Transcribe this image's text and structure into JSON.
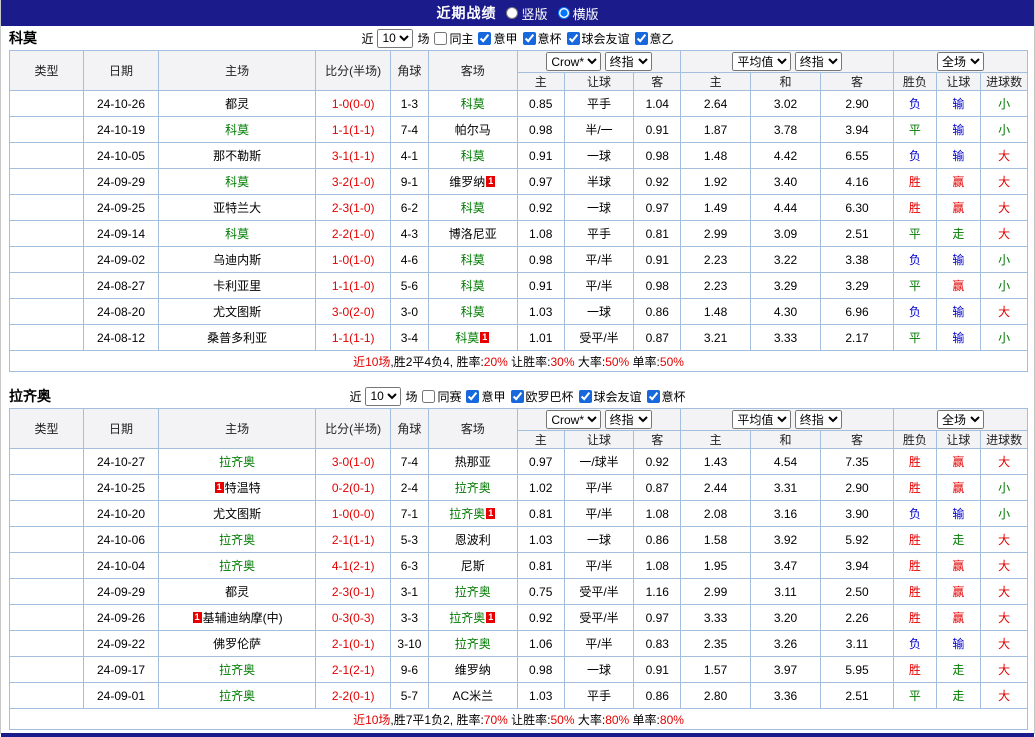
{
  "colors": {
    "navy": "#1b1b8c",
    "red": "#e60000",
    "blue": "#0000d0",
    "green": "#007b00",
    "black": "#000000",
    "league_blue": "#0f8ff0",
    "league_purple": "#8420a8",
    "border": "#a3bfdd"
  },
  "result_color_map": {
    "胜": "red",
    "平": "green",
    "负": "blue",
    "赢": "red",
    "走": "green",
    "输": "blue",
    "大": "red",
    "小": "green"
  },
  "topbar": {
    "title": "近期战绩",
    "options": [
      {
        "label": "竖版",
        "checked": false
      },
      {
        "label": "横版",
        "checked": true
      }
    ]
  },
  "filters_labels": {
    "near": "近",
    "games": "场"
  },
  "table_headers": {
    "type": "类型",
    "date": "日期",
    "home": "主场",
    "score": "比分(半场)",
    "corner": "角球",
    "away": "客场",
    "company_dd": "Crow*",
    "final_dd": "终指",
    "avg_dd": "平均值",
    "final2_dd": "终指",
    "full_dd": "全场",
    "h_home": "主",
    "h_handicap": "让球",
    "h_away": "客",
    "a_home": "主",
    "a_draw": "和",
    "a_away": "客",
    "f_result": "胜负",
    "f_handicap": "让球",
    "f_goals": "进球数"
  },
  "sections": [
    {
      "team": "科莫",
      "filters": {
        "count": "10",
        "same_label": "同主",
        "same_checked": false,
        "leagues": [
          {
            "label": "意甲",
            "checked": true
          },
          {
            "label": "意杯",
            "checked": true
          },
          {
            "label": "球会友谊",
            "checked": true
          },
          {
            "label": "意乙",
            "checked": true
          }
        ]
      },
      "rows": [
        {
          "league": "意甲",
          "lcolor": "blue",
          "date": "24-10-26",
          "home": {
            "name": "都灵"
          },
          "score": "1-0(0-0)",
          "corner": "1-3",
          "away": {
            "name": "科莫",
            "subject": true
          },
          "odds": [
            "0.85",
            "平手",
            "1.04"
          ],
          "avg": [
            "2.64",
            "3.02",
            "2.90"
          ],
          "res": [
            "负",
            "输",
            "小"
          ]
        },
        {
          "league": "意甲",
          "lcolor": "blue",
          "date": "24-10-19",
          "home": {
            "name": "科莫",
            "subject": true
          },
          "score": "1-1(1-1)",
          "corner": "7-4",
          "away": {
            "name": "帕尔马"
          },
          "odds": [
            "0.98",
            "半/一",
            "0.91"
          ],
          "avg": [
            "1.87",
            "3.78",
            "3.94"
          ],
          "res": [
            "平",
            "输",
            "小"
          ]
        },
        {
          "league": "意甲",
          "lcolor": "blue",
          "date": "24-10-05",
          "home": {
            "name": "那不勒斯"
          },
          "score": "3-1(1-1)",
          "corner": "4-1",
          "away": {
            "name": "科莫",
            "subject": true
          },
          "odds": [
            "0.91",
            "一球",
            "0.98"
          ],
          "avg": [
            "1.48",
            "4.42",
            "6.55"
          ],
          "res": [
            "负",
            "输",
            "大"
          ]
        },
        {
          "league": "意甲",
          "lcolor": "blue",
          "date": "24-09-29",
          "home": {
            "name": "科莫",
            "subject": true
          },
          "score": "3-2(1-0)",
          "corner": "9-1",
          "away": {
            "name": "维罗纳",
            "badge": {
              "text": "1",
              "pos": "after"
            }
          },
          "odds": [
            "0.97",
            "半球",
            "0.92"
          ],
          "avg": [
            "1.92",
            "3.40",
            "4.16"
          ],
          "res": [
            "胜",
            "赢",
            "大"
          ]
        },
        {
          "league": "意甲",
          "lcolor": "blue",
          "date": "24-09-25",
          "home": {
            "name": "亚特兰大"
          },
          "score": "2-3(1-0)",
          "corner": "6-2",
          "away": {
            "name": "科莫",
            "subject": true
          },
          "odds": [
            "0.92",
            "一球",
            "0.97"
          ],
          "avg": [
            "1.49",
            "4.44",
            "6.30"
          ],
          "res": [
            "胜",
            "赢",
            "大"
          ]
        },
        {
          "league": "意甲",
          "lcolor": "blue",
          "date": "24-09-14",
          "home": {
            "name": "科莫",
            "subject": true
          },
          "score": "2-2(1-0)",
          "corner": "4-3",
          "away": {
            "name": "博洛尼亚"
          },
          "odds": [
            "1.08",
            "平手",
            "0.81"
          ],
          "avg": [
            "2.99",
            "3.09",
            "2.51"
          ],
          "res": [
            "平",
            "走",
            "大"
          ]
        },
        {
          "league": "意甲",
          "lcolor": "blue",
          "date": "24-09-02",
          "home": {
            "name": "乌迪内斯"
          },
          "score": "1-0(1-0)",
          "corner": "4-6",
          "away": {
            "name": "科莫",
            "subject": true
          },
          "odds": [
            "0.98",
            "平/半",
            "0.91"
          ],
          "avg": [
            "2.23",
            "3.22",
            "3.38"
          ],
          "res": [
            "负",
            "输",
            "小"
          ]
        },
        {
          "league": "意甲",
          "lcolor": "blue",
          "date": "24-08-27",
          "home": {
            "name": "卡利亚里"
          },
          "score": "1-1(1-0)",
          "corner": "5-6",
          "away": {
            "name": "科莫",
            "subject": true
          },
          "odds": [
            "0.91",
            "平/半",
            "0.98"
          ],
          "avg": [
            "2.23",
            "3.29",
            "3.29"
          ],
          "res": [
            "平",
            "赢",
            "小"
          ]
        },
        {
          "league": "意甲",
          "lcolor": "blue",
          "date": "24-08-20",
          "home": {
            "name": "尤文图斯"
          },
          "score": "3-0(2-0)",
          "corner": "3-0",
          "away": {
            "name": "科莫",
            "subject": true
          },
          "odds": [
            "1.03",
            "一球",
            "0.86"
          ],
          "avg": [
            "1.48",
            "4.30",
            "6.96"
          ],
          "res": [
            "负",
            "输",
            "大"
          ]
        },
        {
          "league": "意杯",
          "lcolor": "purple",
          "date": "24-08-12",
          "home": {
            "name": "桑普多利亚"
          },
          "score": "1-1(1-1)",
          "corner": "3-4",
          "away": {
            "name": "科莫",
            "subject": true,
            "badge": {
              "text": "1",
              "pos": "after"
            }
          },
          "odds": [
            "1.01",
            "受平/半",
            "0.87"
          ],
          "avg": [
            "3.21",
            "3.33",
            "2.17"
          ],
          "res": [
            "平",
            "输",
            "小"
          ]
        }
      ],
      "summary": [
        [
          "近10场",
          "red"
        ],
        [
          ",胜2平4负4, 胜率:",
          "black"
        ],
        [
          "20%",
          "red"
        ],
        [
          " 让胜率:",
          "black"
        ],
        [
          "30%",
          "red"
        ],
        [
          " 大率:",
          "black"
        ],
        [
          "50%",
          "red"
        ],
        [
          " 单率:",
          "black"
        ],
        [
          "50%",
          "red"
        ]
      ]
    },
    {
      "team": "拉齐奥",
      "filters": {
        "count": "10",
        "same_label": "同赛",
        "same_checked": false,
        "leagues": [
          {
            "label": "意甲",
            "checked": true
          },
          {
            "label": "欧罗巴杯",
            "checked": true
          },
          {
            "label": "球会友谊",
            "checked": true
          },
          {
            "label": "意杯",
            "checked": true
          }
        ]
      },
      "rows": [
        {
          "league": "意甲",
          "lcolor": "blue",
          "date": "24-10-27",
          "home": {
            "name": "拉齐奥",
            "subject": true
          },
          "score": "3-0(1-0)",
          "corner": "7-4",
          "away": {
            "name": "热那亚"
          },
          "odds": [
            "0.97",
            "一/球半",
            "0.92"
          ],
          "avg": [
            "1.43",
            "4.54",
            "7.35"
          ],
          "res": [
            "胜",
            "赢",
            "大"
          ]
        },
        {
          "league": "欧罗巴杯",
          "lcolor": "purple",
          "date": "24-10-25",
          "home": {
            "name": "特温特",
            "badge": {
              "text": "1",
              "pos": "before"
            }
          },
          "score": "0-2(0-1)",
          "corner": "2-4",
          "away": {
            "name": "拉齐奥",
            "subject": true
          },
          "odds": [
            "1.02",
            "平/半",
            "0.87"
          ],
          "avg": [
            "2.44",
            "3.31",
            "2.90"
          ],
          "res": [
            "胜",
            "赢",
            "小"
          ]
        },
        {
          "league": "意甲",
          "lcolor": "blue",
          "date": "24-10-20",
          "home": {
            "name": "尤文图斯"
          },
          "score": "1-0(0-0)",
          "corner": "7-1",
          "away": {
            "name": "拉齐奥",
            "subject": true,
            "badge": {
              "text": "1",
              "pos": "after"
            }
          },
          "odds": [
            "0.81",
            "平/半",
            "1.08"
          ],
          "avg": [
            "2.08",
            "3.16",
            "3.90"
          ],
          "res": [
            "负",
            "输",
            "小"
          ]
        },
        {
          "league": "意甲",
          "lcolor": "blue",
          "date": "24-10-06",
          "home": {
            "name": "拉齐奥",
            "subject": true
          },
          "score": "2-1(1-1)",
          "corner": "5-3",
          "away": {
            "name": "恩波利"
          },
          "odds": [
            "1.03",
            "一球",
            "0.86"
          ],
          "avg": [
            "1.58",
            "3.92",
            "5.92"
          ],
          "res": [
            "胜",
            "走",
            "大"
          ]
        },
        {
          "league": "欧罗巴杯",
          "lcolor": "purple",
          "date": "24-10-04",
          "home": {
            "name": "拉齐奥",
            "subject": true
          },
          "score": "4-1(2-1)",
          "corner": "6-3",
          "away": {
            "name": "尼斯"
          },
          "odds": [
            "0.81",
            "平/半",
            "1.08"
          ],
          "avg": [
            "1.95",
            "3.47",
            "3.94"
          ],
          "res": [
            "胜",
            "赢",
            "大"
          ]
        },
        {
          "league": "意甲",
          "lcolor": "blue",
          "date": "24-09-29",
          "home": {
            "name": "都灵"
          },
          "score": "2-3(0-1)",
          "corner": "3-1",
          "away": {
            "name": "拉齐奥",
            "subject": true
          },
          "odds": [
            "0.75",
            "受平/半",
            "1.16"
          ],
          "avg": [
            "2.99",
            "3.11",
            "2.50"
          ],
          "res": [
            "胜",
            "赢",
            "大"
          ]
        },
        {
          "league": "欧罗巴杯",
          "lcolor": "purple",
          "date": "24-09-26",
          "home": {
            "name": "基辅迪纳摩(中)",
            "badge": {
              "text": "1",
              "pos": "before"
            }
          },
          "score": "0-3(0-3)",
          "corner": "3-3",
          "away": {
            "name": "拉齐奥",
            "subject": true,
            "badge": {
              "text": "1",
              "pos": "after"
            }
          },
          "odds": [
            "0.92",
            "受平/半",
            "0.97"
          ],
          "avg": [
            "3.33",
            "3.20",
            "2.26"
          ],
          "res": [
            "胜",
            "赢",
            "大"
          ]
        },
        {
          "league": "意甲",
          "lcolor": "blue",
          "date": "24-09-22",
          "home": {
            "name": "佛罗伦萨"
          },
          "score": "2-1(0-1)",
          "corner": "3-10",
          "away": {
            "name": "拉齐奥",
            "subject": true
          },
          "odds": [
            "1.06",
            "平/半",
            "0.83"
          ],
          "avg": [
            "2.35",
            "3.26",
            "3.11"
          ],
          "res": [
            "负",
            "输",
            "大"
          ]
        },
        {
          "league": "意甲",
          "lcolor": "blue",
          "date": "24-09-17",
          "home": {
            "name": "拉齐奥",
            "subject": true
          },
          "score": "2-1(2-1)",
          "corner": "9-6",
          "away": {
            "name": "维罗纳"
          },
          "odds": [
            "0.98",
            "一球",
            "0.91"
          ],
          "avg": [
            "1.57",
            "3.97",
            "5.95"
          ],
          "res": [
            "胜",
            "走",
            "大"
          ]
        },
        {
          "league": "意甲",
          "lcolor": "blue",
          "date": "24-09-01",
          "home": {
            "name": "拉齐奥",
            "subject": true
          },
          "score": "2-2(0-1)",
          "corner": "5-7",
          "away": {
            "name": "AC米兰"
          },
          "odds": [
            "1.03",
            "平手",
            "0.86"
          ],
          "avg": [
            "2.80",
            "3.36",
            "2.51"
          ],
          "res": [
            "平",
            "走",
            "大"
          ]
        }
      ],
      "summary": [
        [
          "近10场",
          "red"
        ],
        [
          ",胜7平1负2, 胜率:",
          "black"
        ],
        [
          "70%",
          "red"
        ],
        [
          " 让胜率:",
          "black"
        ],
        [
          "50%",
          "red"
        ],
        [
          " 大率:",
          "black"
        ],
        [
          "80%",
          "red"
        ],
        [
          " 单率:",
          "black"
        ],
        [
          "80%",
          "red"
        ]
      ]
    }
  ]
}
